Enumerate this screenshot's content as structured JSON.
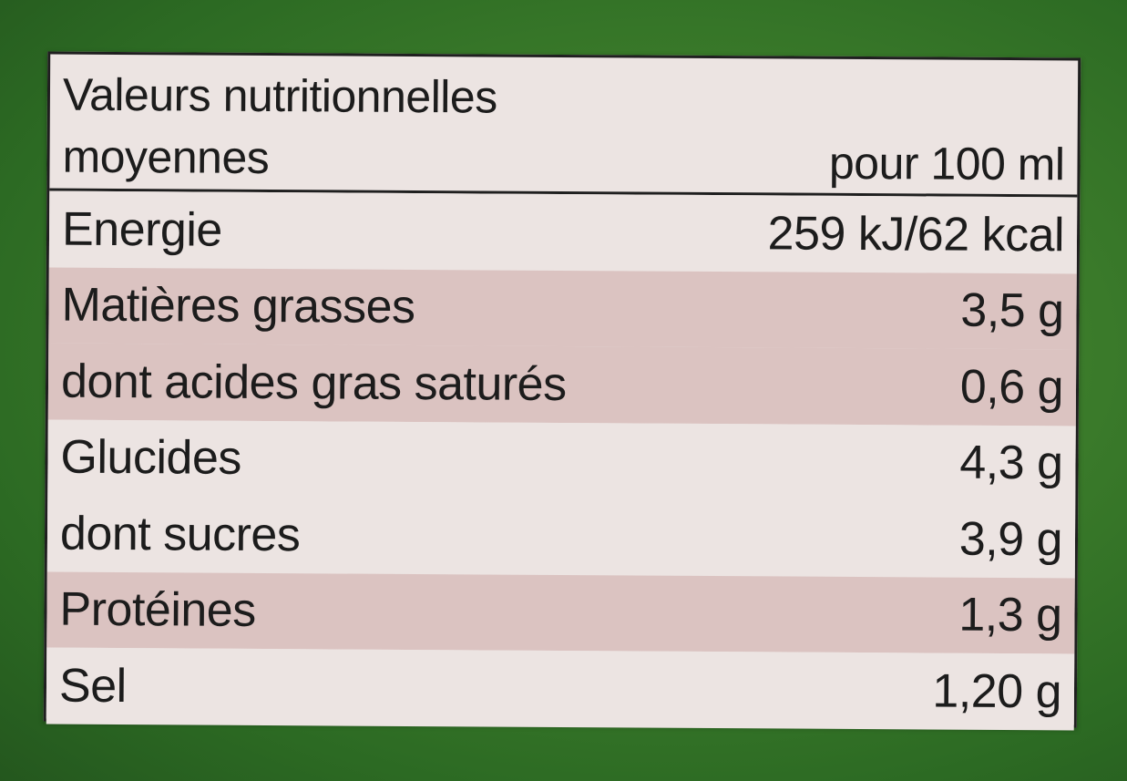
{
  "table": {
    "title_line1": "Valeurs nutritionnelles",
    "title_line2": "moyennes",
    "unit_header": "pour 100 ml",
    "rows": [
      {
        "name": "Energie",
        "value": "259 kJ/62 kcal",
        "shade": "light"
      },
      {
        "name": "Matières grasses",
        "value": "3,5 g",
        "shade": "shaded"
      },
      {
        "name": "dont acides gras saturés",
        "value": "0,6 g",
        "shade": "shaded"
      },
      {
        "name": "Glucides",
        "value": "4,3 g",
        "shade": "light"
      },
      {
        "name": "dont sucres",
        "value": "3,9 g",
        "shade": "light"
      },
      {
        "name": "Protéines",
        "value": "1,3 g",
        "shade": "shaded"
      },
      {
        "name": "Sel",
        "value": "1,20 g",
        "shade": "light"
      }
    ]
  },
  "colors": {
    "background_green": "#3a7a2a",
    "label_background": "#ece4e2",
    "row_shade": "#dbc3c1",
    "text": "#1c1c1c"
  }
}
